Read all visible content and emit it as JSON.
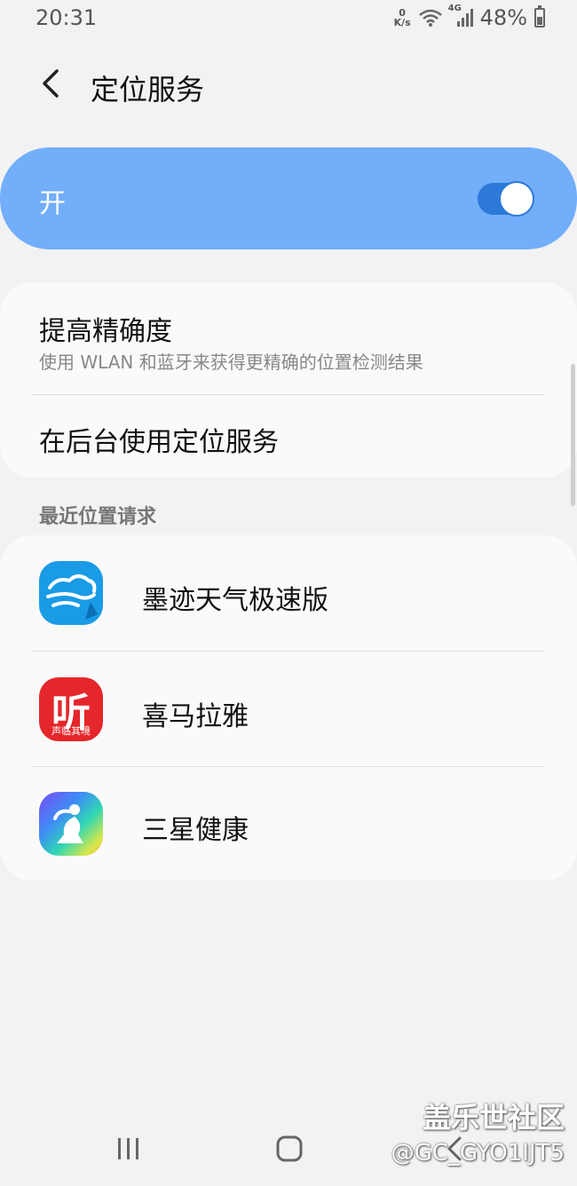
{
  "status_bar": {
    "time": "20:31",
    "net_speed_value": "0",
    "net_speed_unit": "K/s",
    "network_type": "4G",
    "battery_percent": "48%",
    "battery_level": 0.48
  },
  "header": {
    "title": "定位服务",
    "back_icon": "chevron-left-icon"
  },
  "master_switch": {
    "label": "开",
    "state": "on",
    "color_bg": "#72aefa",
    "color_toggle": "#2d79d9"
  },
  "settings": [
    {
      "title": "提高精确度",
      "subtitle": "使用 WLAN 和蓝牙来获得更精确的位置检测结果"
    },
    {
      "title": "在后台使用定位服务"
    }
  ],
  "recent_requests": {
    "header": "最近位置请求",
    "apps": [
      {
        "name": "墨迹天气极速版",
        "icon": "moji-weather-icon"
      },
      {
        "name": "喜马拉雅",
        "icon": "ximalaya-icon",
        "icon_text": "听",
        "icon_caption": "声临其境"
      },
      {
        "name": "三星健康",
        "icon": "samsung-health-icon"
      }
    ]
  },
  "nav_bar": {
    "recent": "recent-apps-icon",
    "home": "home-icon",
    "back": "back-icon"
  },
  "watermark": {
    "site": "盖乐世社区",
    "user": "@GC_GYO1IJT5"
  }
}
